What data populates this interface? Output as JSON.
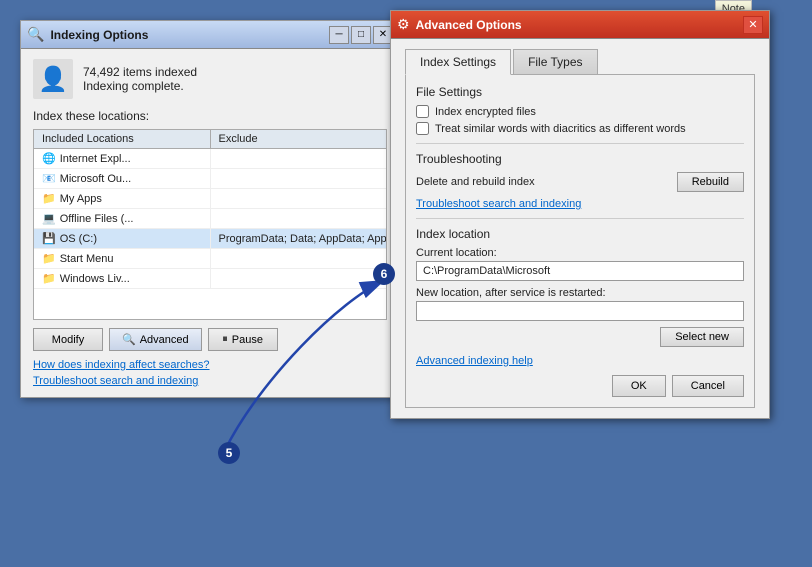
{
  "indexing_window": {
    "title": "Indexing Options",
    "items_indexed": "74,492 items indexed",
    "indexing_status": "Indexing complete.",
    "index_locations_label": "Index these locations:",
    "table_headers": [
      "Included Locations",
      "Exclude"
    ],
    "table_rows": [
      {
        "name": "Internet Expl...",
        "exclude": "",
        "icon": "🌐"
      },
      {
        "name": "Microsoft Ou...",
        "exclude": "",
        "icon": "📧"
      },
      {
        "name": "My Apps",
        "exclude": "",
        "icon": "📁"
      },
      {
        "name": "Offline Files (...",
        "exclude": "",
        "icon": "💻"
      },
      {
        "name": "OS (C:)",
        "exclude": "ProgramData; Data; AppData; AppData; ...",
        "icon": "💾"
      },
      {
        "name": "Start Menu",
        "exclude": "",
        "icon": "📁"
      },
      {
        "name": "Windows Liv...",
        "exclude": "",
        "icon": "📁"
      }
    ],
    "buttons": {
      "modify": "Modify",
      "advanced": "Advanced",
      "pause": "Pause"
    },
    "links": {
      "how_does": "How does indexing affect searches?",
      "troubleshoot": "Troubleshoot search and indexing"
    }
  },
  "advanced_window": {
    "title": "Advanced Options",
    "tabs": [
      "Index Settings",
      "File Types"
    ],
    "file_settings_label": "File Settings",
    "checkboxes": {
      "index_encrypted": "Index encrypted files",
      "treat_similar": "Treat similar words with diacritics as different words"
    },
    "troubleshooting_label": "Troubleshooting",
    "delete_rebuild_label": "Delete and rebuild index",
    "rebuild_btn": "Rebuild",
    "troubleshoot_link": "Troubleshoot search and indexing",
    "index_location_label": "Index location",
    "current_location_label": "Current location:",
    "current_location_value": "C:\\ProgramData\\Microsoft",
    "new_location_label": "New location, after service is restarted:",
    "new_location_value": "",
    "select_new_btn": "Select new",
    "advanced_help_link": "Advanced indexing help",
    "ok_btn": "OK",
    "cancel_btn": "Cancel"
  },
  "annotations": {
    "circle5_label": "5",
    "circle6_label": "6"
  },
  "note_tab": "Note"
}
